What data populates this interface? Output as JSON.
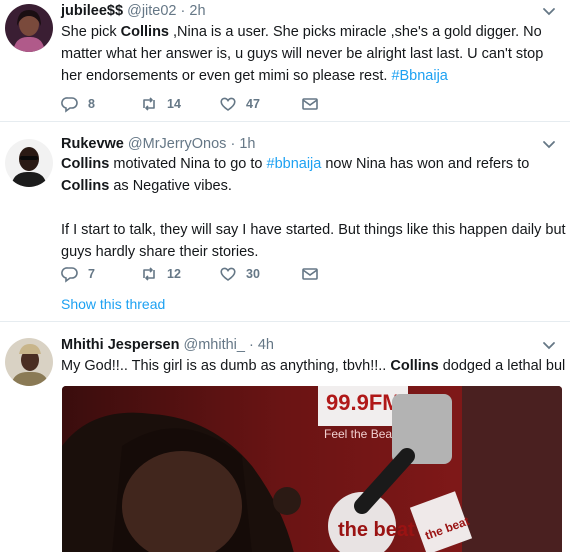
{
  "tweets": [
    {
      "name": "jubilee$$",
      "handle": "@jite02",
      "dot": "·",
      "time": "2h",
      "text": {
        "p1_before": "She pick ",
        "p1_bold": "Collins",
        "p1_after": " ,Nina is a user. She picks miracle ,she's a gold digger. No matter what her answer is,  u guys will never be alright last last. U can't stop her endorsements or even get mimi so please rest. ",
        "hashtag": "#Bbnaija"
      },
      "replies": "8",
      "retweets": "14",
      "likes": "47"
    },
    {
      "name": "Rukevwe",
      "handle": "@MrJerryOnos",
      "dot": "·",
      "time": "1h",
      "text": {
        "bold1": "Collins",
        "t1": " motivated Nina to go to ",
        "hashtag": "#bbnaija",
        "t2": " now Nina has won and refers to ",
        "bold2": "Collins",
        "t3": " as Negative vibes.",
        "p2": "If I start to talk, they will say I have started. But things like this happen daily but guys hardly share their stories."
      },
      "replies": "7",
      "retweets": "12",
      "likes": "30",
      "show_thread": "Show this thread"
    },
    {
      "name": "Mhithi Jespersen",
      "handle": "@mhithi_",
      "dot": "·",
      "time": "4h",
      "text": {
        "t1": "My God!!.. This girl is as dumb as anything, tbvh!!.. ",
        "bold": "Collins",
        "t2": " dodged a lethal bullet..."
      },
      "media_text": {
        "station": "99.9FM",
        "tagline": "Feel the Beat",
        "brand": "the beat",
        "mic_flag": "the beat"
      }
    }
  ],
  "colors": {
    "link": "#1da1f2",
    "secondary": "#657786",
    "divider": "#e6ecf0"
  },
  "icons": [
    "reply-icon",
    "retweet-icon",
    "like-icon",
    "message-icon",
    "chevron-down-icon"
  ]
}
